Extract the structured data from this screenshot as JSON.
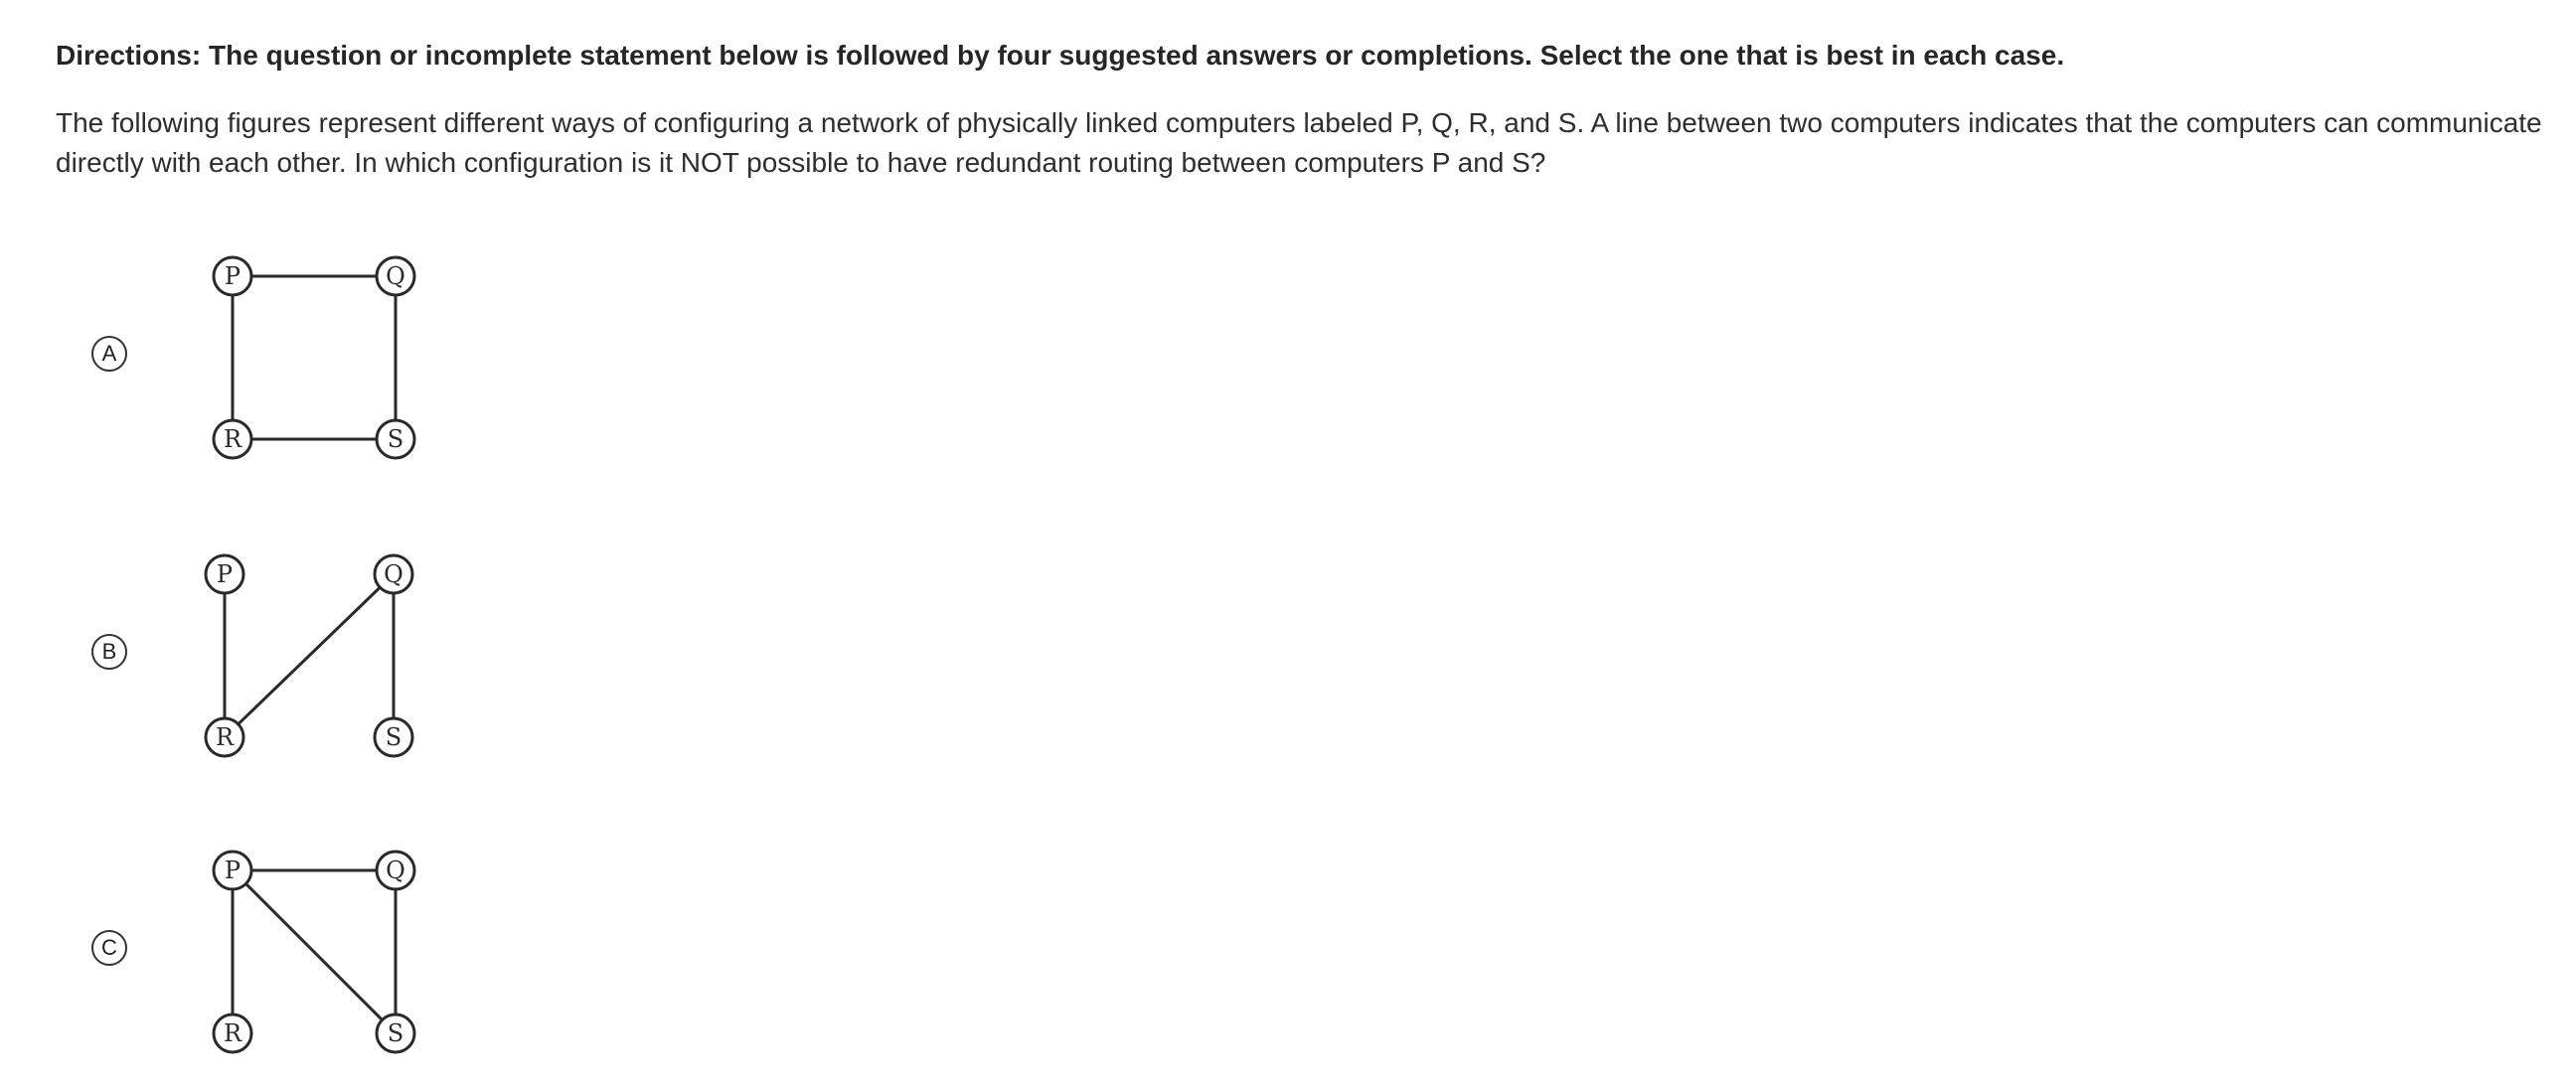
{
  "question": {
    "directions": "Directions: The question or incomplete statement below is followed by four suggested answers or completions. Select the one that is best in each case.",
    "stem": "The following figures represent different ways of configuring a network of physically linked computers labeled P, Q, R, and S. A line between two computers indicates that the computers can communicate directly with each other. In which configuration is it NOT possible to have redundant routing between computers P and S?"
  },
  "choices": [
    {
      "letter": "A",
      "nodes": [
        "P",
        "Q",
        "R",
        "S"
      ],
      "edges": [
        [
          "P",
          "Q"
        ],
        [
          "P",
          "R"
        ],
        [
          "Q",
          "S"
        ],
        [
          "R",
          "S"
        ]
      ]
    },
    {
      "letter": "B",
      "nodes": [
        "P",
        "Q",
        "R",
        "S"
      ],
      "edges": [
        [
          "P",
          "R"
        ],
        [
          "R",
          "Q"
        ],
        [
          "Q",
          "S"
        ]
      ]
    },
    {
      "letter": "C",
      "nodes": [
        "P",
        "Q",
        "R",
        "S"
      ],
      "edges": [
        [
          "P",
          "Q"
        ],
        [
          "P",
          "R"
        ],
        [
          "P",
          "S"
        ],
        [
          "Q",
          "S"
        ]
      ]
    }
  ]
}
